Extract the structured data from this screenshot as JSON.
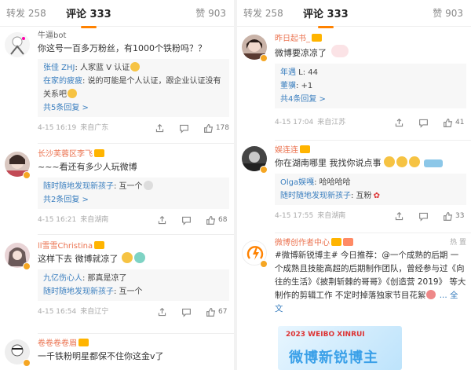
{
  "left": {
    "tabs": {
      "repost": "转发 258",
      "comments": "评论 333",
      "likes": "赞 903"
    },
    "comments": [
      {
        "user": "牛逼bot",
        "text": "你这号一百多万粉丝，有1000个铁粉吗？？",
        "replies": [
          {
            "name": "张佳 ZHJ",
            "sep": ":",
            "text": " 人家蓝 V 认证"
          },
          {
            "name": "在家的疲疲",
            "sep": ":",
            "text": " 说的可能是个人认证，跟企业认证没有关系吧"
          }
        ],
        "more": "共5条回复 >",
        "time": "4-15 16:19",
        "location": "来自广东",
        "likes": "178"
      },
      {
        "user": "长沙芙蓉区李飞",
        "text": "~~~看还有多少人玩微博",
        "replies": [
          {
            "name": "随时随地发现新孩子",
            "sep": ":",
            "text": " 互一个"
          }
        ],
        "more": "共2条回复 >",
        "time": "4-15 16:21",
        "location": "来自湖南",
        "likes": "68"
      },
      {
        "user": "ll雪雪Christina",
        "text": "这样下去 微博就凉了",
        "replies": [
          {
            "name": "九亿伤心人",
            "sep": ":",
            "text": " 那真是凉了"
          },
          {
            "name": "随时随地发现新孩子",
            "sep": ":",
            "text": " 互一个"
          }
        ],
        "more": "",
        "time": "4-15 16:54",
        "location": "来自辽宁",
        "likes": "67"
      },
      {
        "user": "卷卷卷卷眉",
        "text": "一千铁粉明星都保不住你这金v了",
        "replies": [],
        "more": "",
        "time": "",
        "location": "",
        "likes": ""
      }
    ]
  },
  "right": {
    "tabs": {
      "repost": "转发 258",
      "comments": "评论 333",
      "likes": "赞 903"
    },
    "comments": [
      {
        "user": "昨日起书_",
        "text": "微博要凉凉了",
        "replies": [
          {
            "name": "年遇",
            "sep": "",
            "text": " L: 44"
          },
          {
            "name": "董骥",
            "sep": ":",
            "text": " +1"
          }
        ],
        "more": "共4条回复 >",
        "time": "4-15 17:04",
        "location": "来自江苏",
        "likes": "41"
      },
      {
        "user": "娱连连",
        "text": "你在湖南哪里 我找你说点事",
        "replies": [
          {
            "name": "Olga娱嘎",
            "sep": ":",
            "text": " 哈哈哈哈"
          },
          {
            "name": "随时随地发现新孩子",
            "sep": ":",
            "text": " 互粉"
          }
        ],
        "more": "",
        "time": "4-15 17:55",
        "location": "来自湖南",
        "likes": "33"
      },
      {
        "user": "微博创作者中心",
        "pinned": "热 置",
        "text": "#微博新锐博主# 今日推荐：@一个成熟的后期 一个成熟且技能高超的后期制作团队，曾经参与过《向往的生活》《披荆斩棘的哥哥》《创造营 2019》 等大制作的剪辑工作 不定时掉落独家节目花絮",
        "fulltext": "... 全文",
        "promo_small": "2023 WEIBO XINRUI",
        "promo_big": "微博新锐博主"
      }
    ]
  },
  "colors": {
    "accent": "#ff8200",
    "username": "#eb7350",
    "link": "#3b7fbf"
  }
}
